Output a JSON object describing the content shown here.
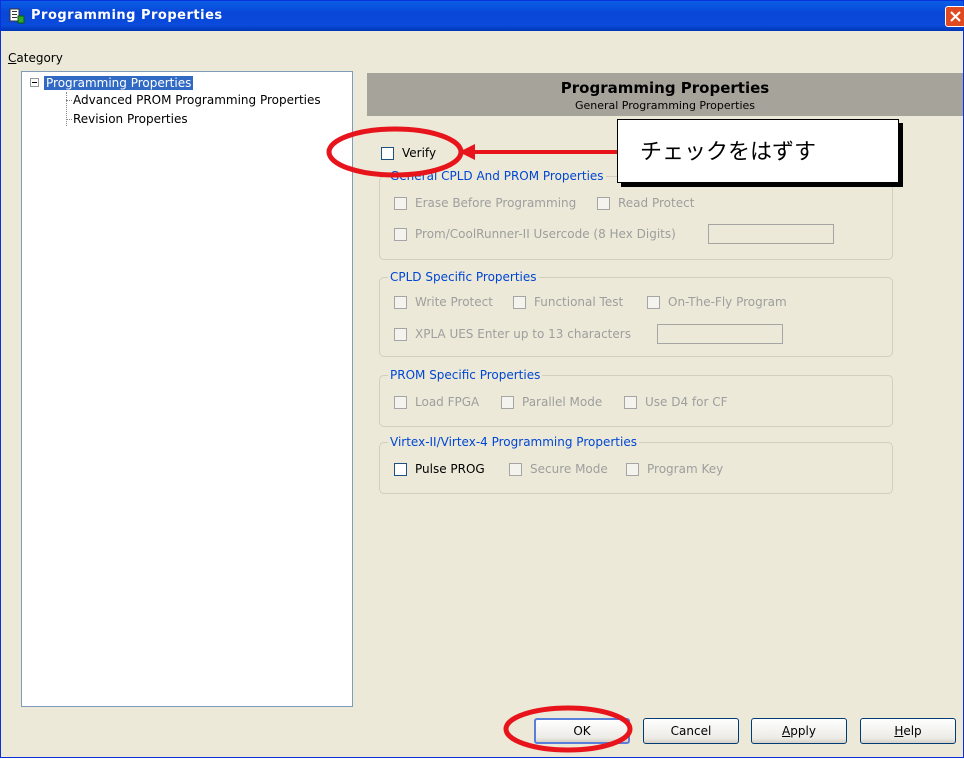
{
  "window": {
    "title": "Programming Properties"
  },
  "category": {
    "label_first": "C",
    "label_rest": "ategory"
  },
  "tree": {
    "root": "Programming Properties",
    "children": [
      "Advanced PROM Programming Properties",
      "Revision Properties"
    ]
  },
  "panel": {
    "title": "Programming Properties",
    "subtitle": "General Programming Properties",
    "verify_label": "Verify",
    "general_group": {
      "title": "General CPLD And PROM Properties",
      "erase_label": "Erase Before Programming",
      "read_protect_label": "Read Protect",
      "usercode_label": "Prom/CoolRunner-II Usercode (8 Hex Digits)",
      "usercode_value": ""
    },
    "cpld_group": {
      "title": "CPLD Specific Properties",
      "write_protect_label": "Write Protect",
      "functional_test_label": "Functional Test",
      "on_the_fly_label": "On-The-Fly Program",
      "xpla_label": "XPLA UES Enter up to 13 characters",
      "xpla_value": ""
    },
    "prom_group": {
      "title": "PROM Specific Properties",
      "load_fpga_label": "Load FPGA",
      "parallel_mode_label": "Parallel Mode",
      "use_d4_label": "Use D4 for CF"
    },
    "virtex_group": {
      "title": "Virtex-II/Virtex-4 Programming Properties",
      "pulse_prog_label": "Pulse PROG",
      "secure_mode_label": "Secure Mode",
      "program_key_label": "Program Key"
    }
  },
  "annotation": {
    "callout_text": "チェックをはずす",
    "highlight_color": "#e8141b"
  },
  "buttons": {
    "ok": "OK",
    "cancel": "Cancel",
    "apply_first": "A",
    "apply_rest": "pply",
    "help_first": "H",
    "help_rest": "elp"
  },
  "colors": {
    "titlebar": "#0a4bdc",
    "selection": "#316ac5",
    "group_title": "#0046d5",
    "dialog_bg": "#ece9d8",
    "header_band": "#a6a39b"
  }
}
